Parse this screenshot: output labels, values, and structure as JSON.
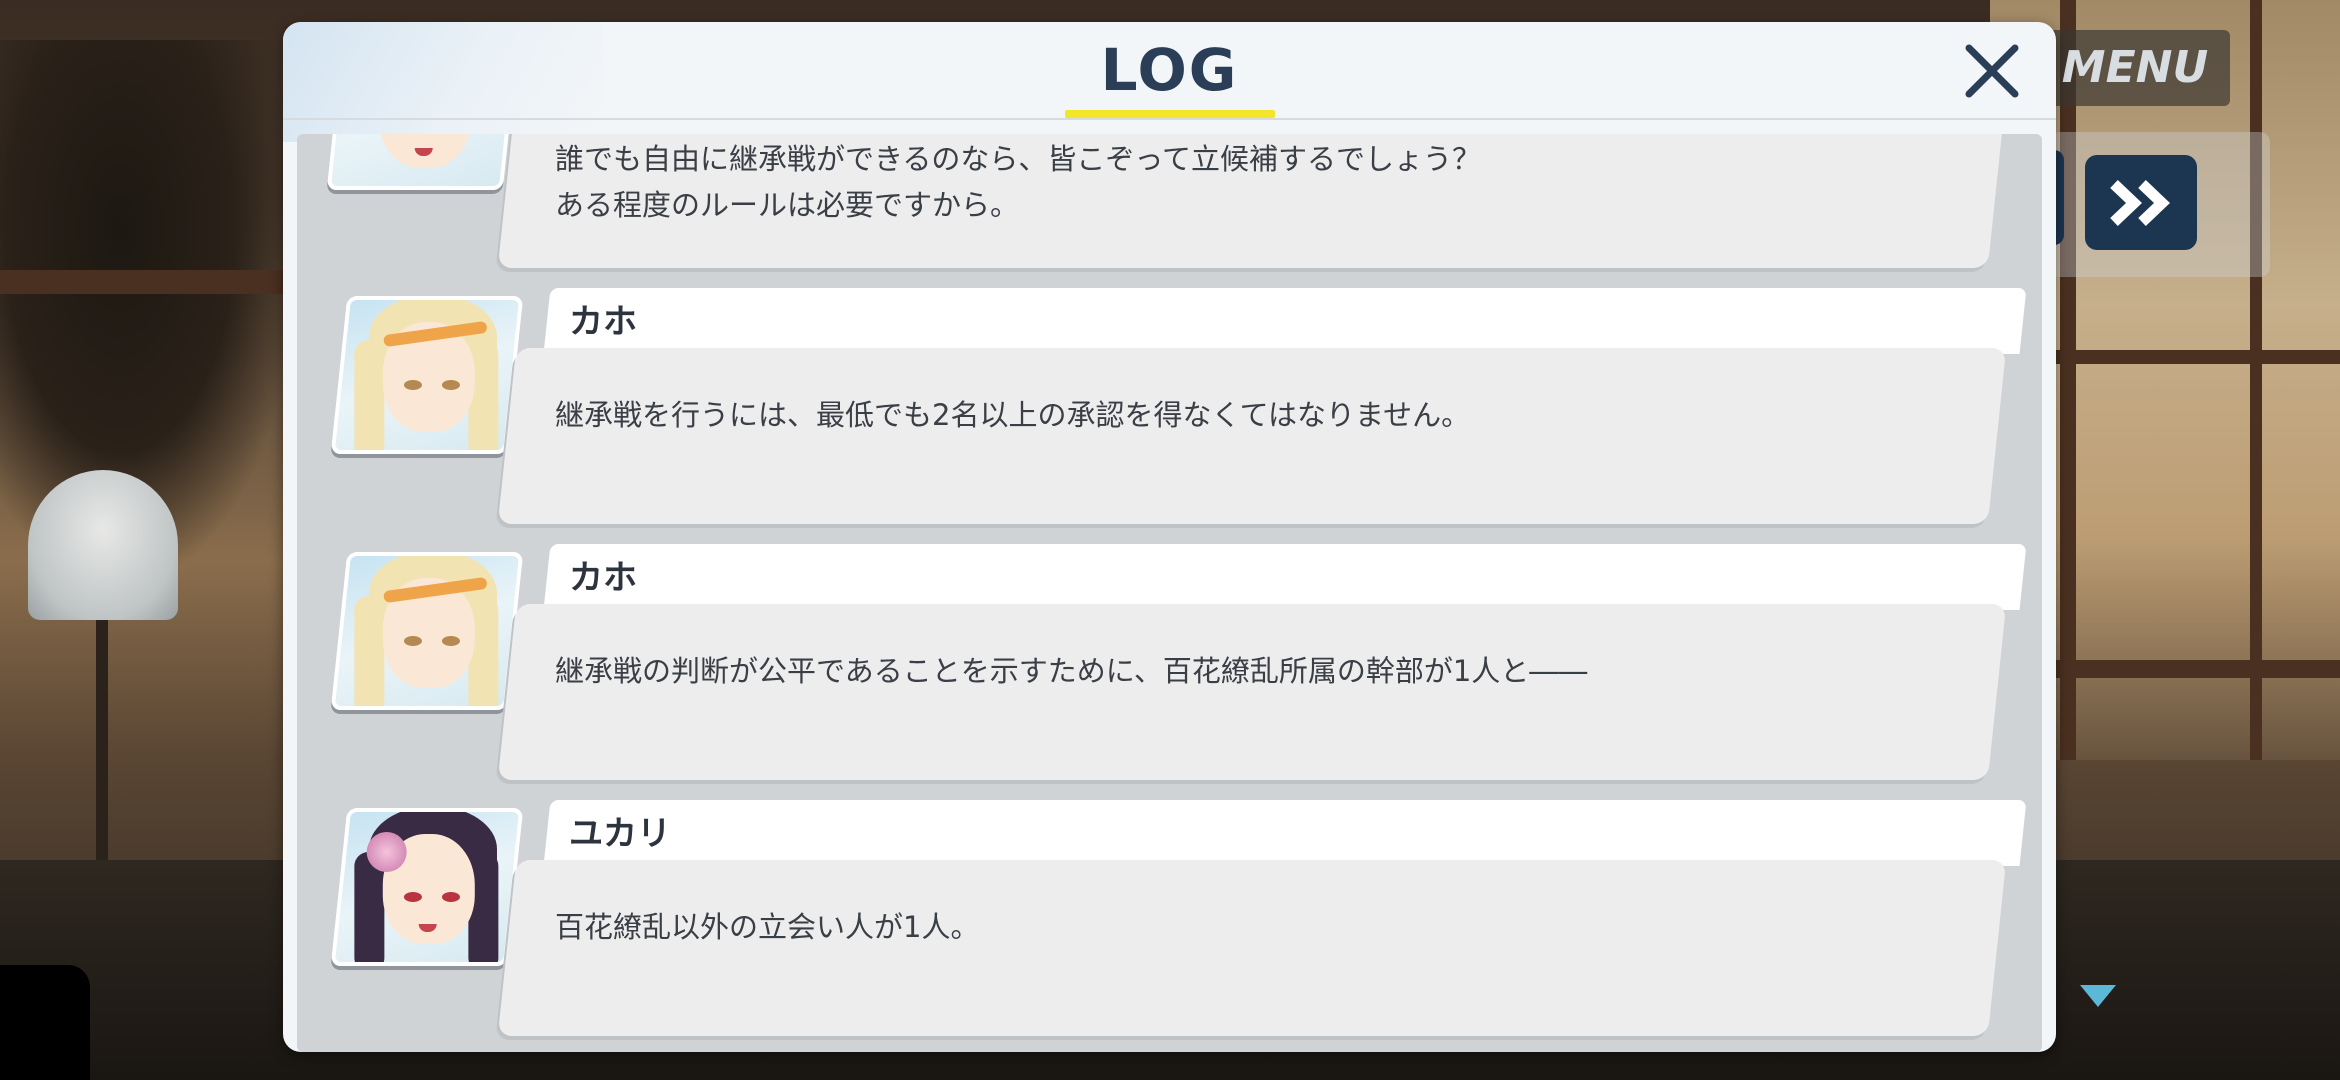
{
  "header": {
    "title": "LOG",
    "menu_label": "MENU"
  },
  "colors": {
    "title": "#2b3e57",
    "title_underline": "#f3e62a",
    "button_dark": "#1c3550",
    "next_indicator": "#5db8d8"
  },
  "icons": {
    "close": "close-icon",
    "skip": "fast-forward-icon",
    "next": "triangle-down-icon"
  },
  "entries": [
    {
      "speaker": "",
      "avatar": "girl1",
      "text": "誰でも自由に継承戦ができるのなら、皆こぞって立候補するでしょう？\nある程度のルールは必要ですから。"
    },
    {
      "speaker": "カホ",
      "avatar": "kaho",
      "text": "継承戦を行うには、最低でも2名以上の承認を得なくてはなりません。"
    },
    {
      "speaker": "カホ",
      "avatar": "kaho",
      "text": "継承戦の判断が公平であることを示すために、百花繚乱所属の幹部が1人と――"
    },
    {
      "speaker": "ユカリ",
      "avatar": "yukari",
      "text": "百花繚乱以外の立会い人が1人。"
    }
  ]
}
